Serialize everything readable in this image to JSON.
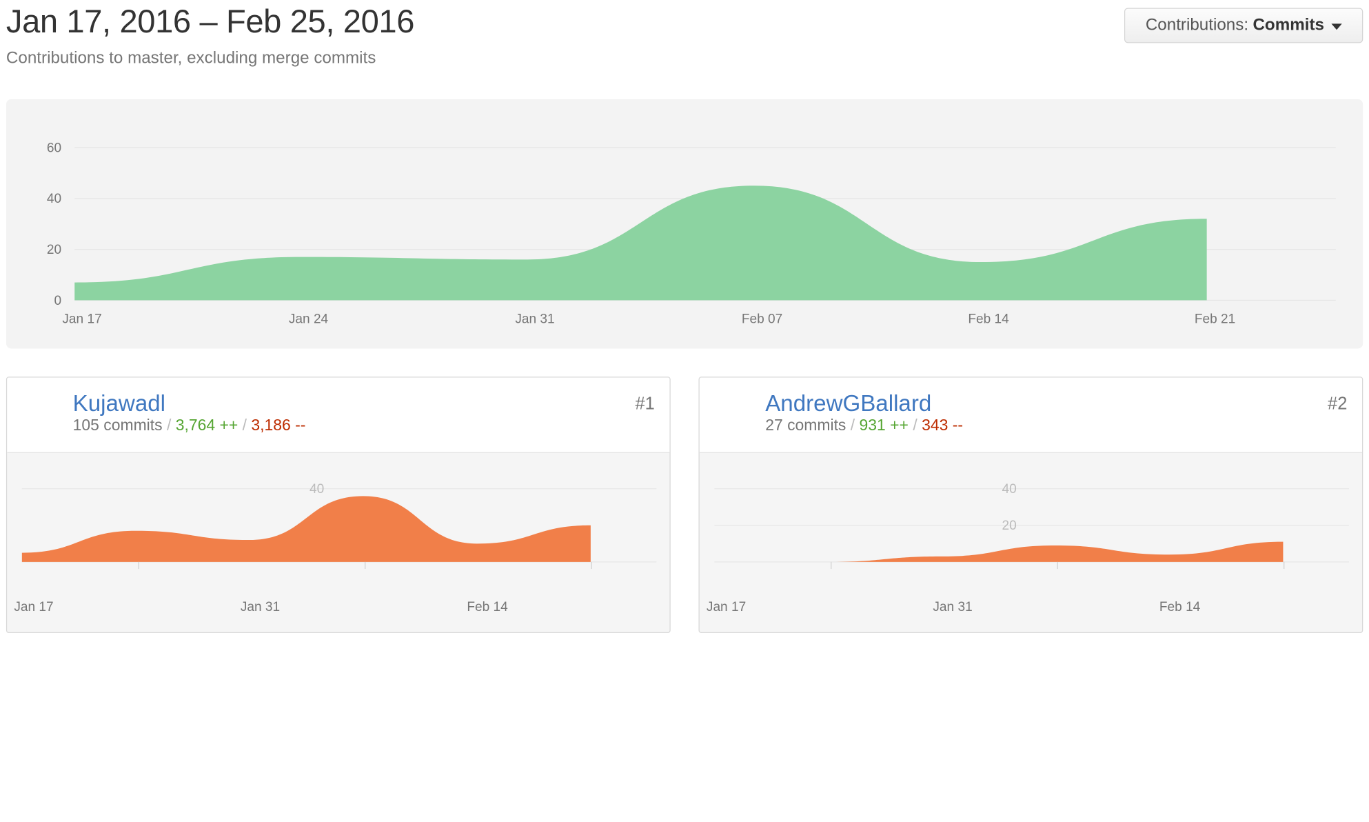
{
  "header": {
    "date_range": "Jan 17, 2016 – Feb 25, 2016",
    "subtitle": "Contributions to master, excluding merge commits"
  },
  "dropdown": {
    "label": "Contributions:",
    "value": "Commits"
  },
  "colors": {
    "main_area": "#8cd3a1",
    "contributor_area": "#f17f49",
    "link": "#4078c0",
    "additions": "#55a532",
    "deletions": "#bd2c00"
  },
  "chart_data": [
    {
      "type": "area",
      "title": "",
      "x": [
        "Jan 17",
        "Jan 24",
        "Jan 31",
        "Feb 07",
        "Feb 14",
        "Feb 21"
      ],
      "x_tick_labels": [
        "Jan 17",
        "Jan 24",
        "Jan 31",
        "Feb 07",
        "Feb 14",
        "Feb 21"
      ],
      "values": [
        7,
        17,
        16,
        45,
        15,
        32
      ],
      "y_ticks": [
        "60",
        "40",
        "20",
        "0"
      ],
      "ylim": [
        0,
        60
      ],
      "grid": true
    },
    {
      "type": "area",
      "x": [
        "Jan 17",
        "Jan 24",
        "Jan 31",
        "Feb 07",
        "Feb 14",
        "Feb 21"
      ],
      "x_tick_labels": [
        "Jan 17",
        "Jan 31",
        "Feb 14"
      ],
      "values": [
        5,
        17,
        12,
        36,
        10,
        20
      ],
      "y_ticks": [
        "40"
      ],
      "ylim": [
        0,
        60
      ],
      "grid": true
    },
    {
      "type": "area",
      "x": [
        "Jan 17",
        "Jan 24",
        "Jan 31",
        "Feb 07",
        "Feb 14",
        "Feb 21"
      ],
      "x_tick_labels": [
        "Jan 17",
        "Jan 31",
        "Feb 14"
      ],
      "values": [
        0,
        0,
        3,
        9,
        4,
        11
      ],
      "y_ticks": [
        "40",
        "20"
      ],
      "ylim": [
        0,
        60
      ],
      "grid": true
    }
  ],
  "contributors": [
    {
      "name": "Kujawadl",
      "commits": "105 commits",
      "sep1": "/",
      "additions": "3,764 ++",
      "sep2": "/",
      "deletions": "3,186 --",
      "rank": "#1"
    },
    {
      "name": "AndrewGBallard",
      "commits": "27 commits",
      "sep1": "/",
      "additions": "931 ++",
      "sep2": "/",
      "deletions": "343 --",
      "rank": "#2"
    }
  ]
}
